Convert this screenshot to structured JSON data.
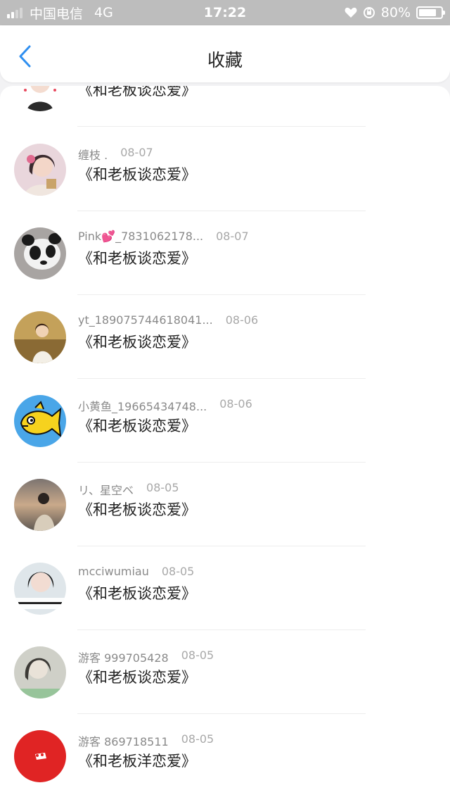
{
  "status_bar": {
    "carrier": "中国电信",
    "network": "4G",
    "time": "17:22",
    "battery": "80%",
    "battery_level": 0.8
  },
  "header": {
    "title": "收藏",
    "back_icon": "chevron-left-icon"
  },
  "colors": {
    "accent": "#2f8ff0",
    "header_bg": "#ffffff",
    "status_bar_bg": "#bdbdbd"
  },
  "items": [
    {
      "name": "",
      "date": "",
      "title": "《和老板谈恋爱》"
    },
    {
      "name": "缠枝 .",
      "date": "08-07",
      "title": "《和老板谈恋爱》"
    },
    {
      "name": "Pink💕_7831062178...",
      "date": "08-07",
      "title": "《和老板谈恋爱》"
    },
    {
      "name": "yt_189075744618041...",
      "date": "08-06",
      "title": "《和老板谈恋爱》"
    },
    {
      "name": "小黄鱼_19665434748...",
      "date": "08-06",
      "title": "《和老板谈恋爱》"
    },
    {
      "name": "リ、星空ベ",
      "date": "08-05",
      "title": "《和老板谈恋爱》"
    },
    {
      "name": "mcciwumiau",
      "date": "08-05",
      "title": "《和老板谈恋爱》"
    },
    {
      "name": "游客 999705428",
      "date": "08-05",
      "title": "《和老板谈恋爱》"
    },
    {
      "name": "游客 869718511",
      "date": "08-05",
      "title": "《和老板洋恋爱》"
    }
  ]
}
